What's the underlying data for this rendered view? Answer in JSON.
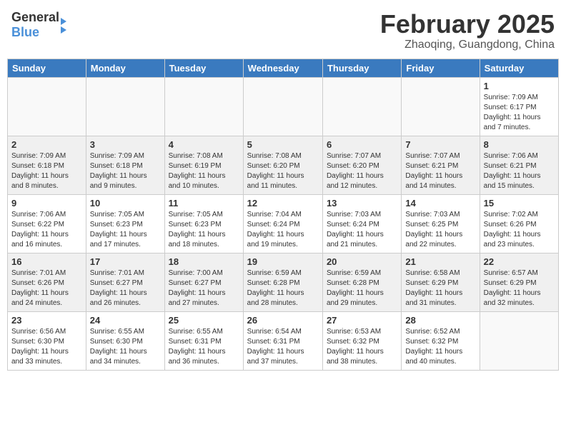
{
  "logo": {
    "general": "General",
    "blue": "Blue"
  },
  "title": {
    "month": "February 2025",
    "location": "Zhaoqing, Guangdong, China"
  },
  "headers": [
    "Sunday",
    "Monday",
    "Tuesday",
    "Wednesday",
    "Thursday",
    "Friday",
    "Saturday"
  ],
  "weeks": [
    {
      "shaded": false,
      "days": [
        {
          "num": "",
          "info": ""
        },
        {
          "num": "",
          "info": ""
        },
        {
          "num": "",
          "info": ""
        },
        {
          "num": "",
          "info": ""
        },
        {
          "num": "",
          "info": ""
        },
        {
          "num": "",
          "info": ""
        },
        {
          "num": "1",
          "info": "Sunrise: 7:09 AM\nSunset: 6:17 PM\nDaylight: 11 hours\nand 7 minutes."
        }
      ]
    },
    {
      "shaded": true,
      "days": [
        {
          "num": "2",
          "info": "Sunrise: 7:09 AM\nSunset: 6:18 PM\nDaylight: 11 hours\nand 8 minutes."
        },
        {
          "num": "3",
          "info": "Sunrise: 7:09 AM\nSunset: 6:18 PM\nDaylight: 11 hours\nand 9 minutes."
        },
        {
          "num": "4",
          "info": "Sunrise: 7:08 AM\nSunset: 6:19 PM\nDaylight: 11 hours\nand 10 minutes."
        },
        {
          "num": "5",
          "info": "Sunrise: 7:08 AM\nSunset: 6:20 PM\nDaylight: 11 hours\nand 11 minutes."
        },
        {
          "num": "6",
          "info": "Sunrise: 7:07 AM\nSunset: 6:20 PM\nDaylight: 11 hours\nand 12 minutes."
        },
        {
          "num": "7",
          "info": "Sunrise: 7:07 AM\nSunset: 6:21 PM\nDaylight: 11 hours\nand 14 minutes."
        },
        {
          "num": "8",
          "info": "Sunrise: 7:06 AM\nSunset: 6:21 PM\nDaylight: 11 hours\nand 15 minutes."
        }
      ]
    },
    {
      "shaded": false,
      "days": [
        {
          "num": "9",
          "info": "Sunrise: 7:06 AM\nSunset: 6:22 PM\nDaylight: 11 hours\nand 16 minutes."
        },
        {
          "num": "10",
          "info": "Sunrise: 7:05 AM\nSunset: 6:23 PM\nDaylight: 11 hours\nand 17 minutes."
        },
        {
          "num": "11",
          "info": "Sunrise: 7:05 AM\nSunset: 6:23 PM\nDaylight: 11 hours\nand 18 minutes."
        },
        {
          "num": "12",
          "info": "Sunrise: 7:04 AM\nSunset: 6:24 PM\nDaylight: 11 hours\nand 19 minutes."
        },
        {
          "num": "13",
          "info": "Sunrise: 7:03 AM\nSunset: 6:24 PM\nDaylight: 11 hours\nand 21 minutes."
        },
        {
          "num": "14",
          "info": "Sunrise: 7:03 AM\nSunset: 6:25 PM\nDaylight: 11 hours\nand 22 minutes."
        },
        {
          "num": "15",
          "info": "Sunrise: 7:02 AM\nSunset: 6:26 PM\nDaylight: 11 hours\nand 23 minutes."
        }
      ]
    },
    {
      "shaded": true,
      "days": [
        {
          "num": "16",
          "info": "Sunrise: 7:01 AM\nSunset: 6:26 PM\nDaylight: 11 hours\nand 24 minutes."
        },
        {
          "num": "17",
          "info": "Sunrise: 7:01 AM\nSunset: 6:27 PM\nDaylight: 11 hours\nand 26 minutes."
        },
        {
          "num": "18",
          "info": "Sunrise: 7:00 AM\nSunset: 6:27 PM\nDaylight: 11 hours\nand 27 minutes."
        },
        {
          "num": "19",
          "info": "Sunrise: 6:59 AM\nSunset: 6:28 PM\nDaylight: 11 hours\nand 28 minutes."
        },
        {
          "num": "20",
          "info": "Sunrise: 6:59 AM\nSunset: 6:28 PM\nDaylight: 11 hours\nand 29 minutes."
        },
        {
          "num": "21",
          "info": "Sunrise: 6:58 AM\nSunset: 6:29 PM\nDaylight: 11 hours\nand 31 minutes."
        },
        {
          "num": "22",
          "info": "Sunrise: 6:57 AM\nSunset: 6:29 PM\nDaylight: 11 hours\nand 32 minutes."
        }
      ]
    },
    {
      "shaded": false,
      "days": [
        {
          "num": "23",
          "info": "Sunrise: 6:56 AM\nSunset: 6:30 PM\nDaylight: 11 hours\nand 33 minutes."
        },
        {
          "num": "24",
          "info": "Sunrise: 6:55 AM\nSunset: 6:30 PM\nDaylight: 11 hours\nand 34 minutes."
        },
        {
          "num": "25",
          "info": "Sunrise: 6:55 AM\nSunset: 6:31 PM\nDaylight: 11 hours\nand 36 minutes."
        },
        {
          "num": "26",
          "info": "Sunrise: 6:54 AM\nSunset: 6:31 PM\nDaylight: 11 hours\nand 37 minutes."
        },
        {
          "num": "27",
          "info": "Sunrise: 6:53 AM\nSunset: 6:32 PM\nDaylight: 11 hours\nand 38 minutes."
        },
        {
          "num": "28",
          "info": "Sunrise: 6:52 AM\nSunset: 6:32 PM\nDaylight: 11 hours\nand 40 minutes."
        },
        {
          "num": "",
          "info": ""
        }
      ]
    }
  ]
}
